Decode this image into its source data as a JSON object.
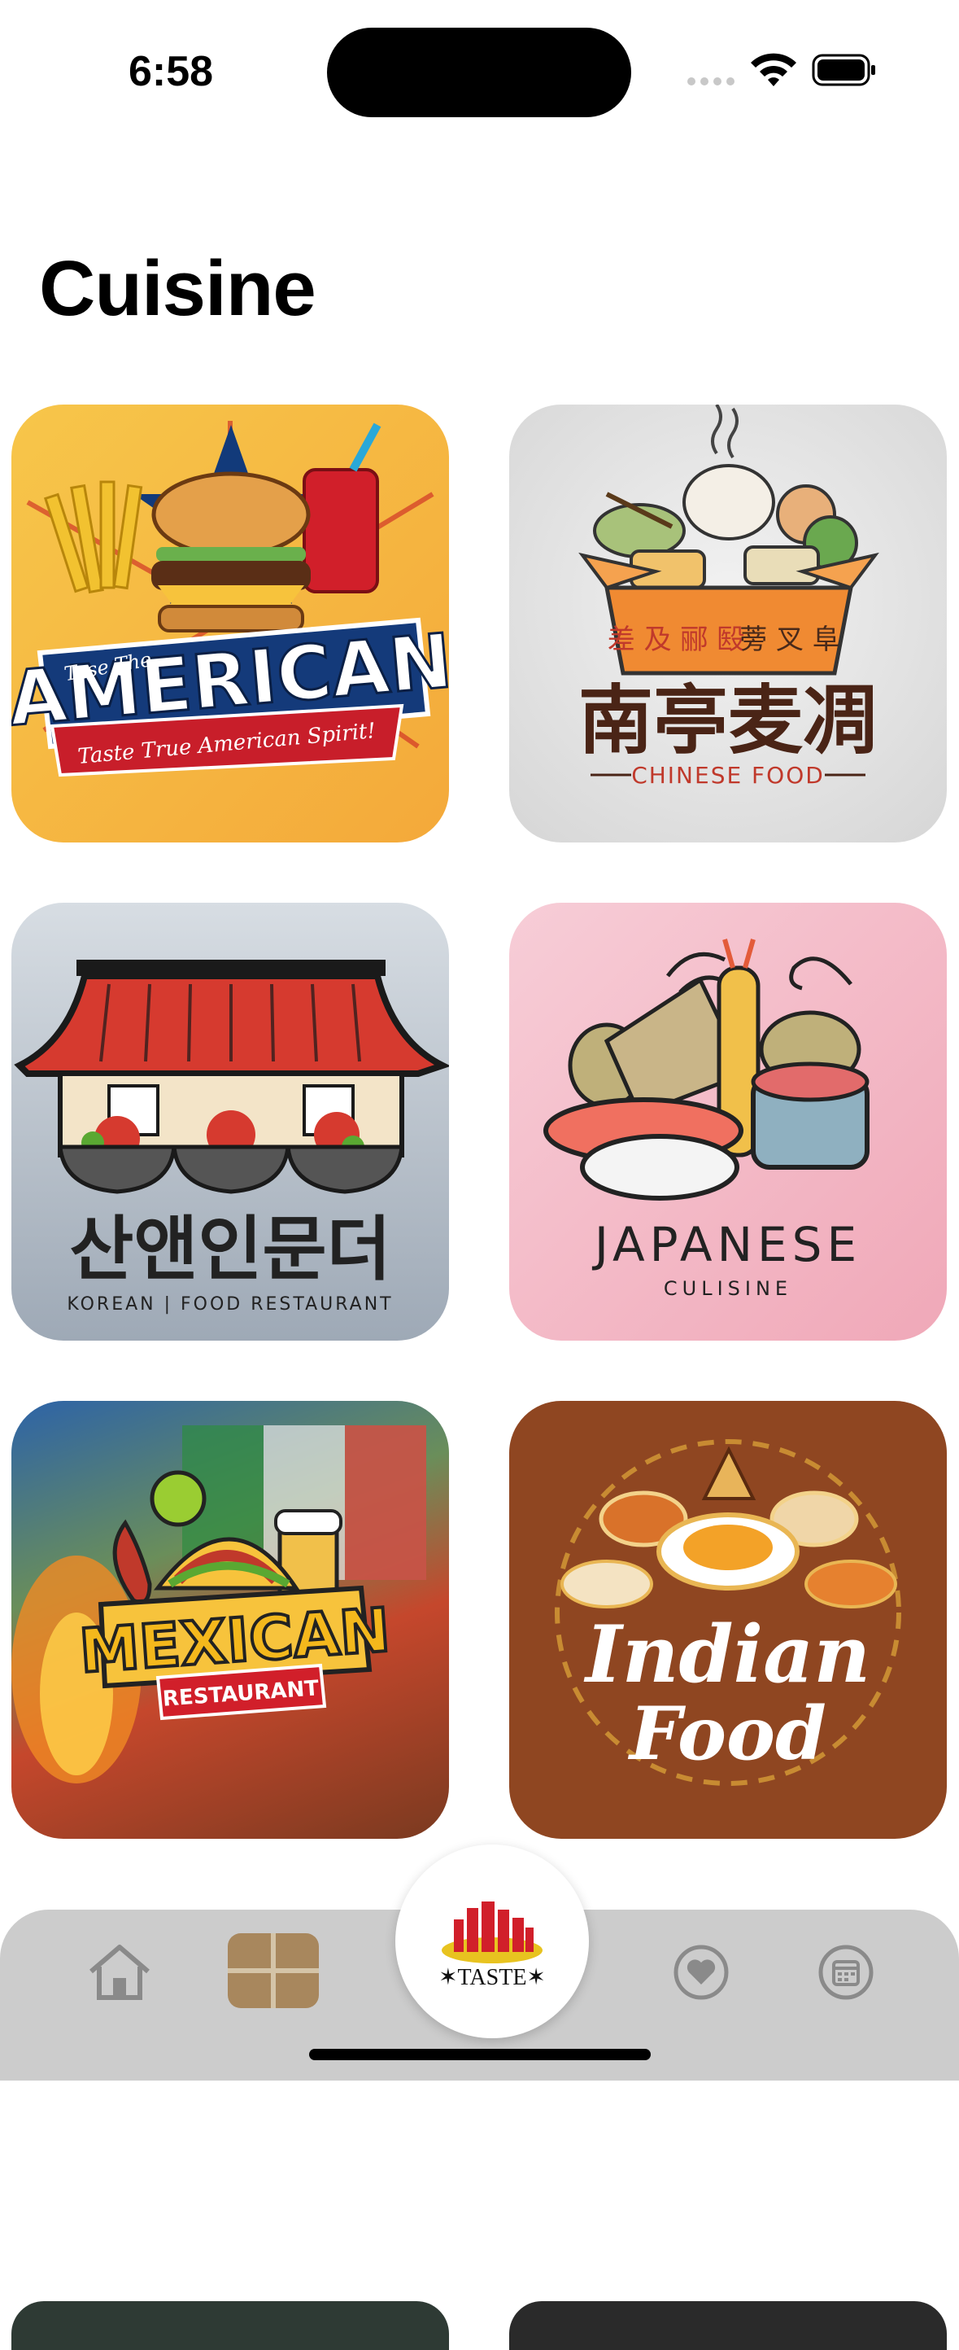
{
  "status_bar": {
    "time": "6:58"
  },
  "page": {
    "title": "Cuisine"
  },
  "cuisines": [
    {
      "name": "American",
      "headline": "AMERICAN",
      "tagline": "Taste True American Spirit!",
      "banner": "Tase The"
    },
    {
      "name": "Chinese",
      "headline": "南亭麦凋",
      "subline": "CHINESE FOOD"
    },
    {
      "name": "Korean",
      "headline": "산앤인문더",
      "subline": "KOREAN | FOOD RESTAURANT"
    },
    {
      "name": "Japanese",
      "headline": "JAPANESE",
      "subline": "CULISINE"
    },
    {
      "name": "Mexican",
      "headline": "MEXICAN",
      "subline": "RESTAURANT"
    },
    {
      "name": "Indian",
      "headline": "Indian",
      "subline": "Food"
    }
  ],
  "tab_bar": {
    "center_label": "✶TASTE✶",
    "items": [
      {
        "icon": "home-icon"
      },
      {
        "icon": "grid-icon",
        "selected": true
      },
      {
        "icon": "heart-icon"
      },
      {
        "icon": "calendar-icon"
      }
    ]
  },
  "colors": {
    "selected_tab": "#a8875d",
    "inactive_tab": "#8a8a8a"
  }
}
